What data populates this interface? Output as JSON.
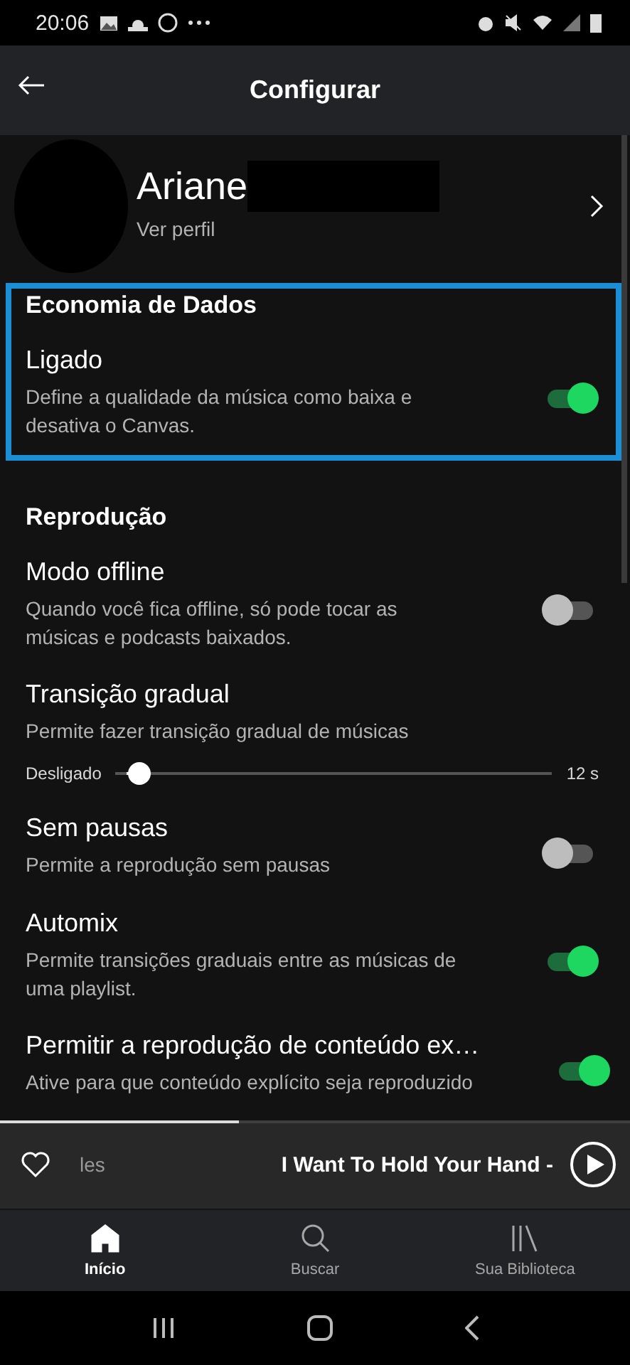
{
  "status_bar": {
    "time": "20:06"
  },
  "header": {
    "title": "Configurar"
  },
  "profile": {
    "name": "Ariane",
    "link": "Ver perfil"
  },
  "data_saver": {
    "title": "Economia de Dados",
    "highlighted": true,
    "item": {
      "kind": "toggle",
      "label": "Ligado",
      "description": "Define a qualidade da música como baixa e desativa o Canvas.",
      "on": true
    }
  },
  "playback": {
    "title": "Reprodução",
    "items": [
      {
        "kind": "toggle",
        "label": "Modo offline",
        "description": "Quando você fica offline, só pode tocar as músicas e podcasts baixados.",
        "on": false
      },
      {
        "kind": "slider",
        "label": "Transição gradual",
        "description": "Permite fazer transição gradual de músicas",
        "min_label": "Desligado",
        "max_label": "12 s",
        "level": 0.03
      },
      {
        "kind": "toggle",
        "label": "Sem pausas",
        "description": "Permite a reprodução sem pausas",
        "on": false
      },
      {
        "kind": "toggle",
        "label": "Automix",
        "description": "Permite transições graduais entre as músicas de uma playlist.",
        "on": true
      },
      {
        "kind": "toggle",
        "label": "Permitir a reprodução de conteúdo ex…",
        "description": "Ative para que conteúdo explícito seja reproduzido",
        "on": true
      }
    ]
  },
  "mini_player": {
    "artist": "les",
    "title": "I Want To Hold Your Hand -",
    "progress": {
      "level": 0.38
    }
  },
  "bottom_nav": [
    {
      "label": "Início",
      "selected": true
    },
    {
      "label": "Buscar",
      "selected": false
    },
    {
      "label": "Sua Biblioteca",
      "selected": false
    }
  ]
}
